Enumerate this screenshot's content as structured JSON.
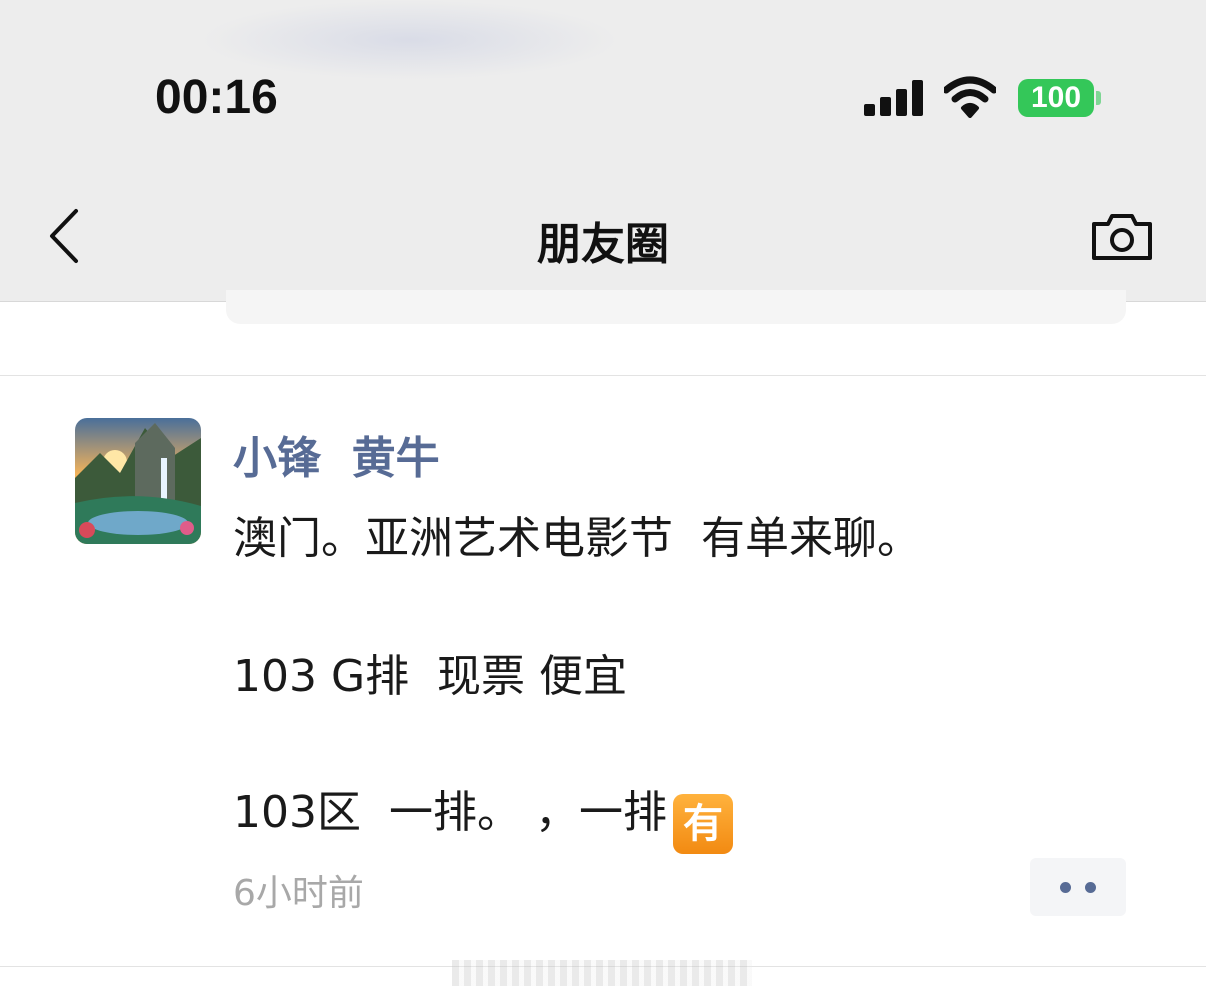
{
  "status_bar": {
    "time": "00:16",
    "battery_level": "100"
  },
  "nav": {
    "title": "朋友圈",
    "back_icon": "chevron-left-icon",
    "camera_icon": "camera-icon"
  },
  "post": {
    "author": "小锋  黄牛",
    "lines": [
      "澳门。亚洲艺术电影节  有单来聊。",
      "103 G排  现票 便宜",
      "103区  一排。 ，一排"
    ],
    "emoji": "有",
    "time_ago": "6小时前"
  },
  "colors": {
    "link_blue": "#576b95",
    "battery_green": "#34c759",
    "topbar_bg": "#ededed"
  }
}
